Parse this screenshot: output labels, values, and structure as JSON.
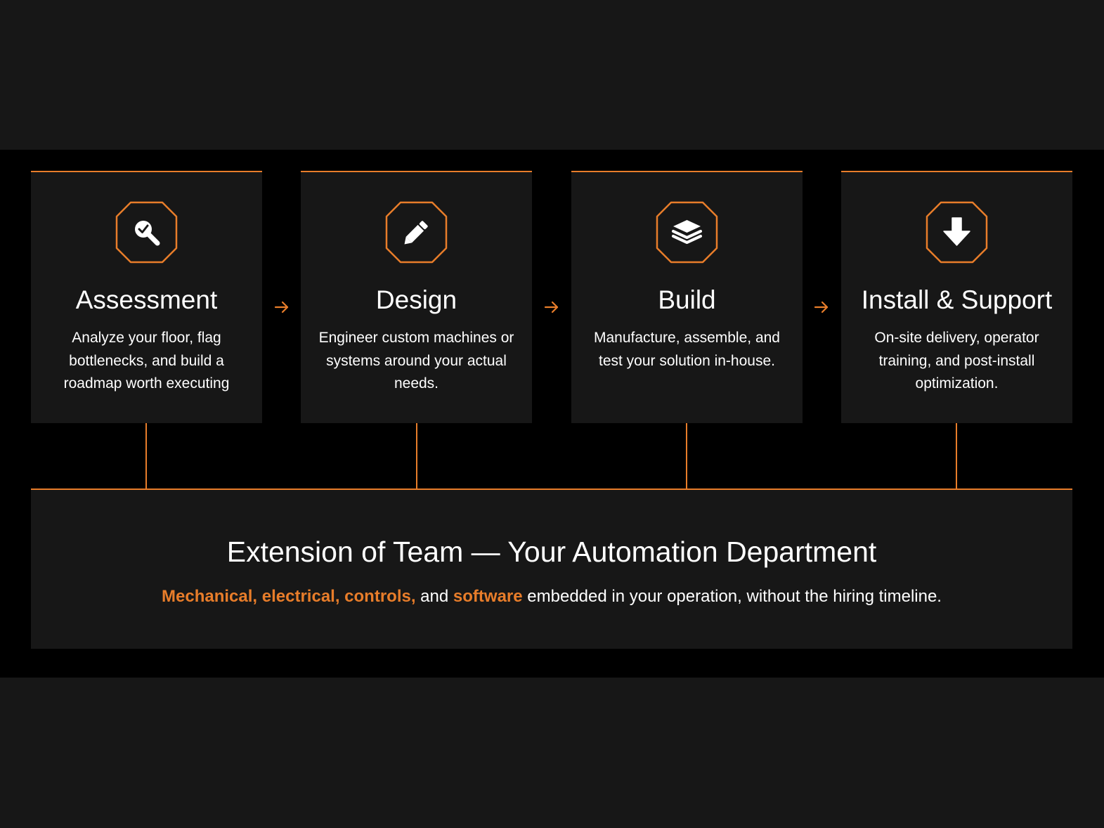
{
  "colors": {
    "accent": "#e87d2a",
    "page_background": "#171717",
    "band_background": "#000000",
    "card_background": "#171717",
    "text": "#ffffff"
  },
  "steps": [
    {
      "title": "Assessment",
      "description": "Analyze your floor, flag bottlenecks, and build a roadmap worth executing",
      "icon": "magnifier-check-icon"
    },
    {
      "title": "Design",
      "description": "Engineer custom machines or systems around your actual needs.",
      "icon": "pencil-icon"
    },
    {
      "title": "Build",
      "description": "Manufacture, assemble, and test your solution in-house.",
      "icon": "layers-icon"
    },
    {
      "title": "Install & Support",
      "description": "On-site delivery, operator training, and post-install optimization.",
      "icon": "arrow-down-icon"
    }
  ],
  "step_arrow_icon": "arrow-right-icon",
  "team_panel": {
    "title": "Extension of Team — Your Automation Department",
    "subtitle": {
      "highlight_1": "Mechanical, electrical, controls,",
      "text_1": " and ",
      "highlight_2": "software",
      "text_2": " embedded in your operation, without the hiring timeline."
    }
  }
}
